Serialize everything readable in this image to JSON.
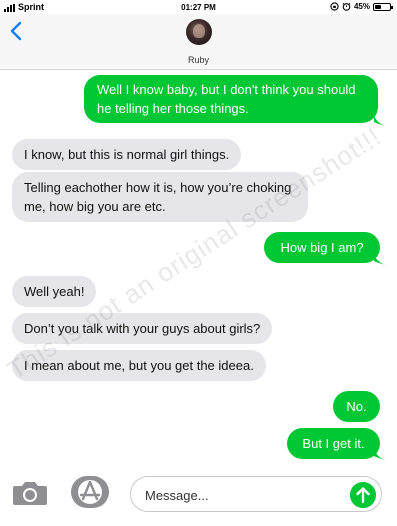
{
  "status_bar": {
    "carrier": "Sprint",
    "time": "01:27 PM",
    "battery": "45%",
    "battery_level": 0.45
  },
  "header": {
    "contact_name": "Ruby",
    "back_icon": "chevron-left-icon"
  },
  "messages": [
    {
      "direction": "outgoing",
      "text": "Well I know baby, but I don't think you should he telling her those things."
    },
    {
      "direction": "incoming",
      "text": "I know, but this is normal girl things."
    },
    {
      "direction": "incoming",
      "text": "Telling eachother how it is, how you’re choking me, how big you are etc."
    },
    {
      "direction": "outgoing",
      "text": "How big I am?"
    },
    {
      "direction": "incoming",
      "text": "Well yeah!"
    },
    {
      "direction": "incoming",
      "text": "Don’t you talk with your guys about girls?"
    },
    {
      "direction": "incoming",
      "text": "I mean about me, but you get the ideea."
    },
    {
      "direction": "outgoing",
      "text": "No."
    },
    {
      "direction": "outgoing",
      "text": "But I get it."
    }
  ],
  "watermark": "This is not an original screenshot!!!",
  "composer": {
    "placeholder": "Message...",
    "camera_icon": "camera-icon",
    "apps_icon": "app-store-icon",
    "send_icon": "send-arrow-icon"
  },
  "colors": {
    "outgoing_bubble": "#00c734",
    "incoming_bubble": "#e5e5ea",
    "ios_blue": "#157efb"
  }
}
